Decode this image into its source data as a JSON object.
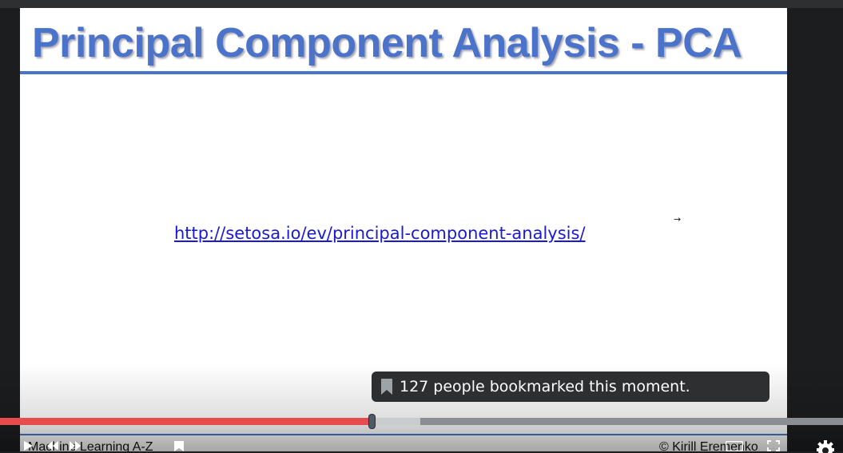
{
  "slide": {
    "title": "Principal Component Analysis - PCA",
    "link": "http://setosa.io/ev/principal-component-analysis/",
    "arrow_glyph": "→",
    "footer_left": "Machine Learning A-Z",
    "footer_right": "© Kirill Eremenko"
  },
  "tooltip": {
    "text": "127 people bookmarked this moment."
  },
  "player": {
    "progress_percent": 44.2,
    "buffered_percent": 49.9,
    "colors": {
      "progress": "#e74c4c",
      "buffer": "#c9cbcd",
      "track": "#8a8d91",
      "title": "#4a73c9",
      "link": "#1a1ad6"
    },
    "icons": [
      "play-icon",
      "rewind-icon",
      "forward-icon",
      "bookmark-icon",
      "captions-icon",
      "settings-icon",
      "fullscreen-icon"
    ]
  }
}
